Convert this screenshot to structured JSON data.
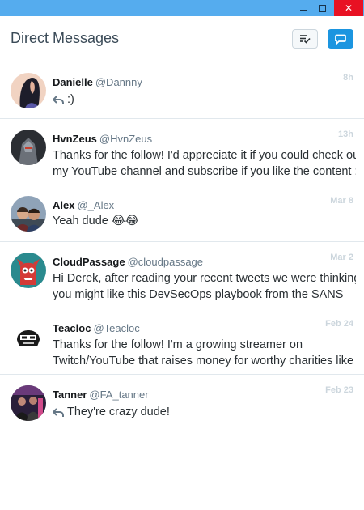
{
  "window": {
    "minimize_icon": "minimize-icon",
    "maximize_icon": "maximize-icon",
    "close_icon": "close-icon",
    "close_glyph": "✕"
  },
  "header": {
    "title": "Direct Messages",
    "mark_read_icon": "mark-all-read-icon",
    "new_message_icon": "new-message-icon"
  },
  "colors": {
    "titlebar": "#55acee",
    "accent": "#1b95e0",
    "close": "#e81123"
  },
  "conversations": [
    {
      "name": "Danielle",
      "handle": "@Dannny",
      "time": "8h",
      "reply": true,
      "message": ":)"
    },
    {
      "name": "HvnZeus",
      "handle": "@HvnZeus",
      "time": "13h",
      "reply": false,
      "message_lines": [
        "Thanks for the follow! I'd appreciate it if you could check out",
        "my YouTube channel and subscribe if you like the content :)"
      ]
    },
    {
      "name": "Alex",
      "handle": "@_Alex",
      "time": "Mar 8",
      "reply": false,
      "message": "Yeah dude 😂😂"
    },
    {
      "name": "CloudPassage",
      "handle": "@cloudpassage",
      "time": "Mar 2",
      "reply": false,
      "message_lines": [
        "Hi Derek, after reading your recent tweets we were thinking",
        "you might like this DevSecOps playbook from the SANS"
      ]
    },
    {
      "name": "Teacloc",
      "handle": "@Teacloc",
      "time": "Feb 24",
      "reply": false,
      "message_lines": [
        "Thanks for the follow! I'm a growing streamer on",
        "Twitch/YouTube that raises money for worthy charities like St."
      ]
    },
    {
      "name": "Tanner",
      "handle": "@FA_tanner",
      "time": "Feb 23",
      "reply": true,
      "message": "They're crazy dude!"
    }
  ]
}
